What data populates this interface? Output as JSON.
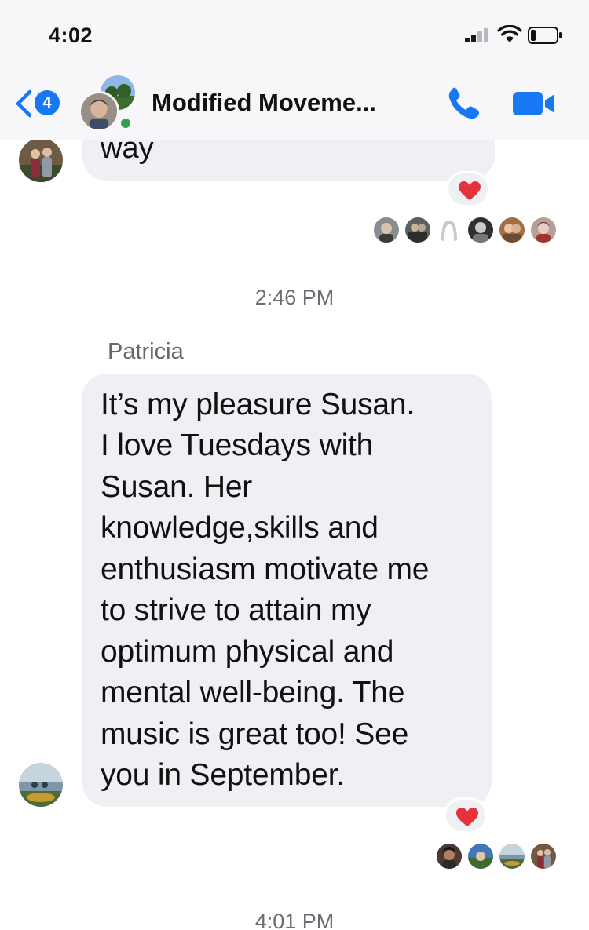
{
  "status_bar": {
    "time": "4:02"
  },
  "header": {
    "back_badge_count": "4",
    "chat_title": "Modified Moveme...",
    "icons": [
      "back-chevron-icon",
      "phone-icon",
      "video-camera-icon"
    ],
    "accent_color": "#1877f2",
    "online_color": "#31a24c"
  },
  "messages": {
    "previous_tail": "way",
    "timestamp_1": "2:46 PM",
    "sender": "Patricia",
    "main_lines": [
      "It’s my pleasure Susan.",
      "I love Tuesdays with",
      "Susan. Her",
      "knowledge,skills and",
      "enthusiasm motivate me",
      "to strive to attain my",
      "optimum physical and",
      "mental well-being. The",
      "music is great too! See",
      "you in September."
    ],
    "timestamp_2": "4:01 PM",
    "reaction_icon": "red-heart-icon",
    "bubble_color": "#eef0f4"
  }
}
